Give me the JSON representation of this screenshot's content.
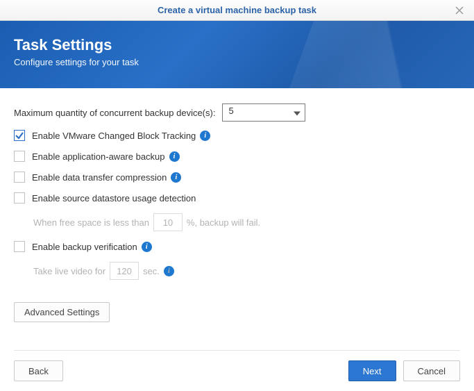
{
  "titlebar": {
    "title": "Create a virtual machine backup task"
  },
  "header": {
    "title": "Task Settings",
    "subtitle": "Configure settings for your task"
  },
  "form": {
    "max_label": "Maximum quantity of concurrent backup device(s):",
    "max_value": "5",
    "opt_vmware": "Enable VMware Changed Block Tracking",
    "opt_appaware": "Enable application-aware backup",
    "opt_compression": "Enable data transfer compression",
    "opt_datastore": "Enable source datastore usage detection",
    "datastore_sub_pre": "When free space is less than",
    "datastore_sub_val": "10",
    "datastore_sub_post": "%, backup will fail.",
    "opt_verification": "Enable backup verification",
    "verification_sub_pre": "Take live video for",
    "verification_sub_val": "120",
    "verification_sub_post": "sec.",
    "advanced": "Advanced Settings"
  },
  "buttons": {
    "back": "Back",
    "next": "Next",
    "cancel": "Cancel"
  }
}
